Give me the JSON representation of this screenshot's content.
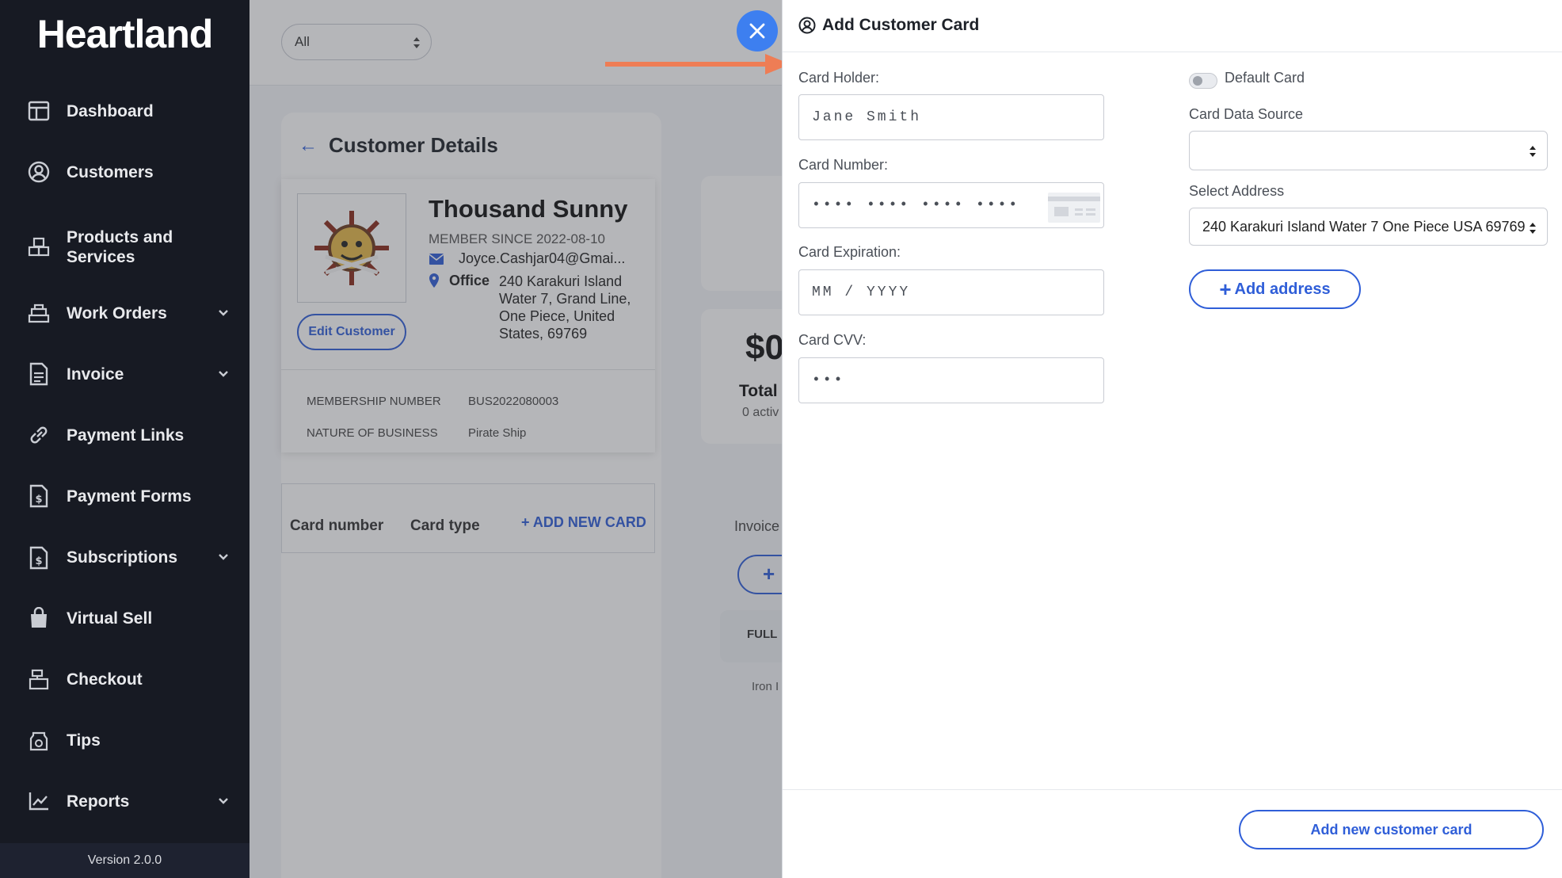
{
  "sidebar": {
    "logo": "Heartland",
    "items": [
      {
        "label": "Dashboard"
      },
      {
        "label": "Customers"
      },
      {
        "label": "Products and Services"
      },
      {
        "label": "Work Orders"
      },
      {
        "label": "Invoice"
      },
      {
        "label": "Payment Links"
      },
      {
        "label": "Payment Forms"
      },
      {
        "label": "Subscriptions"
      },
      {
        "label": "Virtual Sell"
      },
      {
        "label": "Checkout"
      },
      {
        "label": "Tips"
      },
      {
        "label": "Reports"
      }
    ],
    "version": "Version 2.0.0"
  },
  "topbar": {
    "filter_value": "All"
  },
  "customer": {
    "page_title": "Customer Details",
    "name": "Thousand Sunny",
    "member_since": "MEMBER SINCE 2022-08-10",
    "email": "Joyce.Cashjar04@Gmai...",
    "office_label": "Office",
    "office_address": "240 Karakuri Island Water 7, Grand Line, One Piece, United States, 69769",
    "edit_label": "Edit Customer",
    "membership_label": "MEMBERSHIP NUMBER",
    "membership_value": "BUS2022080003",
    "nature_label": "NATURE OF BUSINESS",
    "nature_value": "Pirate Ship",
    "cards_col_number": "Card number",
    "cards_col_type": "Card type",
    "add_card_link": "+ ADD NEW CARD"
  },
  "stats": {
    "amount": "$0",
    "total_label": "Total",
    "active": "0 activ",
    "invoice_tab": "Invoice",
    "plus": "+",
    "full_col": "FULL",
    "iron": "Iron I"
  },
  "drawer": {
    "title": "Add Customer Card",
    "card_holder_label": "Card Holder:",
    "card_holder_value": "Jane Smith",
    "card_number_label": "Card Number:",
    "card_number_placeholder": "•••• •••• •••• ••••",
    "card_expiration_label": "Card Expiration:",
    "card_expiration_placeholder": "MM / YYYY",
    "card_cvv_label": "Card CVV:",
    "card_cvv_placeholder": "•••",
    "default_card_label": "Default Card",
    "default_card_on": false,
    "card_data_source_label": "Card Data Source",
    "card_data_source_value": "",
    "select_address_label": "Select Address",
    "select_address_value": "240 Karakuri Island Water 7 One Piece USA 69769",
    "add_address_label": "Add address",
    "submit_label": "Add new customer card"
  },
  "colors": {
    "sidebar_bg": "#171a23",
    "accent": "#2f5ed8",
    "close_button": "#3d7ff0",
    "annotation_arrow": "#ee7d55"
  }
}
